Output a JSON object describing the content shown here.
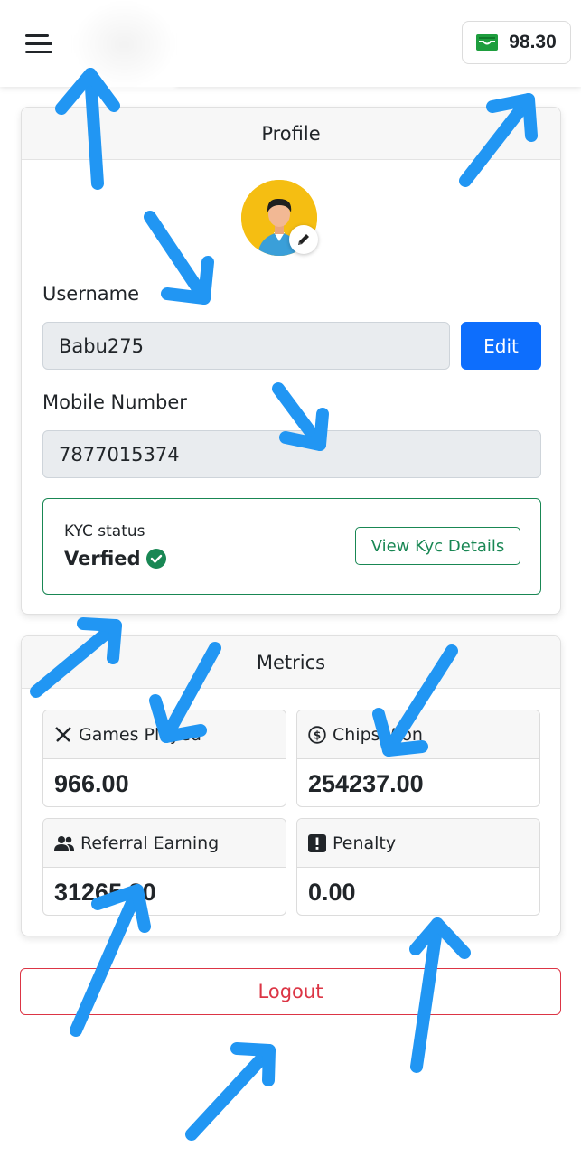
{
  "header": {
    "wallet_amount": "98.30",
    "wallet_icon_color": "#1e9e3e"
  },
  "profile": {
    "title": "Profile",
    "username_label": "Username",
    "username_value": "Babu275",
    "edit_button": "Edit",
    "mobile_label": "Mobile Number",
    "mobile_value": "7877015374",
    "kyc": {
      "label": "KYC status",
      "status": "Verfied",
      "details_button": "View Kyc Details"
    }
  },
  "metrics": {
    "title": "Metrics",
    "items": [
      {
        "icon": "crossed-swords-icon",
        "label": "Games Played",
        "value": "966.00"
      },
      {
        "icon": "chips-coin-icon",
        "label": "Chips Won",
        "value": "254237.00"
      },
      {
        "icon": "users-icon",
        "label": "Referral Earning",
        "value": "31265.80"
      },
      {
        "icon": "exclamation-icon",
        "label": "Penalty",
        "value": "0.00"
      }
    ]
  },
  "logout_label": "Logout",
  "colors": {
    "primary": "#0d6efd",
    "success": "#198754",
    "danger": "#dc3545",
    "annotation_arrow": "#2196f3"
  }
}
